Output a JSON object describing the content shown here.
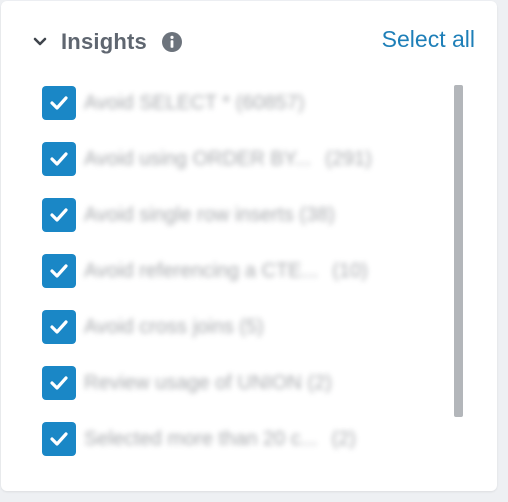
{
  "header": {
    "title": "Insights",
    "select_all_label": "Select all"
  },
  "icons": {
    "collapse": "chevron-down-icon",
    "info": "info-icon",
    "check": "checkmark-icon"
  },
  "colors": {
    "accent": "#1a87c6",
    "link": "#1e7fb8",
    "title": "#5f6670"
  },
  "items": [
    {
      "label": "Avoid SELECT * (60857)",
      "count": "",
      "checked": true
    },
    {
      "label": "Avoid using ORDER BY...",
      "count": "(291)",
      "checked": true
    },
    {
      "label": "Avoid single row inserts (38)",
      "count": "",
      "checked": true
    },
    {
      "label": "Avoid referencing a CTE...",
      "count": "(10)",
      "checked": true
    },
    {
      "label": "Avoid cross joins (5)",
      "count": "",
      "checked": true
    },
    {
      "label": "Review usage of UNION (2)",
      "count": "",
      "checked": true
    },
    {
      "label": "Selected more than 20 c...",
      "count": "(2)",
      "checked": true
    }
  ]
}
